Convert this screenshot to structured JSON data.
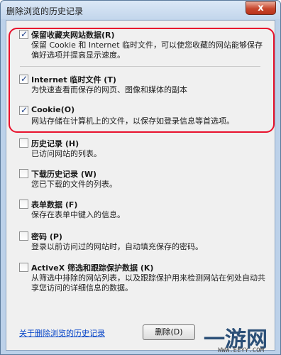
{
  "window": {
    "title": "删除浏览的历史记录",
    "close_label": "x"
  },
  "options": [
    {
      "label": "保留收藏夹网站数据",
      "shortcut": "(R)",
      "checked": true,
      "desc": "保留 Cookie 和 Internet 临时文件，可以使您收藏的网站能够保存偏好选项并提高显示速度。"
    },
    {
      "label": "Internet 临时文件",
      "shortcut": "(T)",
      "checked": true,
      "desc": "为快速查看而保存的网页、图像和媒体的副本"
    },
    {
      "label": "Cookie",
      "shortcut": "(O)",
      "checked": true,
      "desc": "网站存储在计算机上的文件，以保存如登录信息等首选项。"
    },
    {
      "label": "历史记录",
      "shortcut": "(H)",
      "checked": false,
      "desc": "已访问网站的列表。"
    },
    {
      "label": "下载历史记录",
      "shortcut": "(W)",
      "checked": false,
      "desc": "您已下载的文件的列表。"
    },
    {
      "label": "表单数据",
      "shortcut": "(F)",
      "checked": false,
      "desc": "保存在表单中键入的信息。"
    },
    {
      "label": "密码",
      "shortcut": "(P)",
      "checked": false,
      "desc": "登录以前访问过的网站时，自动填充保存的密码。"
    },
    {
      "label": "ActiveX 筛选和跟踪保护数据",
      "shortcut": "(K)",
      "checked": false,
      "desc": "从筛选中排除的网站列表，以及跟踪保护用来检测网站在何处自动共享您访问的详细信息的数据。"
    }
  ],
  "footer": {
    "link_text": "关于删除浏览的历史记录",
    "delete_label": "删除(D)"
  },
  "watermark": {
    "main": "一游网",
    "sub": "WWW.EEYY.COM"
  },
  "colors": {
    "highlight": "#e8122d",
    "link": "#0645c8",
    "check": "#1c3f8a"
  }
}
